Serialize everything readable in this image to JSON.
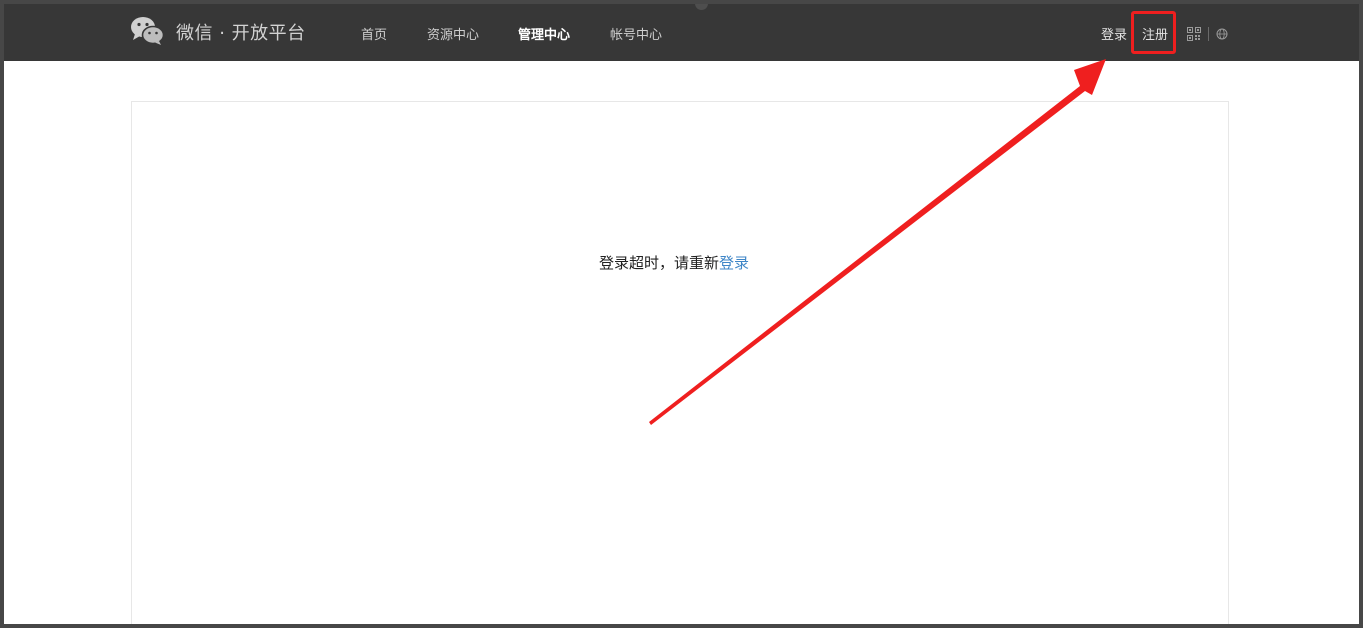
{
  "header": {
    "logo_text": "微信 · 开放平台",
    "nav": [
      {
        "label": "首页"
      },
      {
        "label": "资源中心"
      },
      {
        "label": "管理中心",
        "active": true
      },
      {
        "label": "帐号中心"
      }
    ],
    "login_label": "登录",
    "register_label": "注册",
    "qr_icon": "qr-code-icon",
    "globe_icon": "globe-icon"
  },
  "main": {
    "message_prefix": "登录超时，请重新",
    "relogin_link": "登录"
  },
  "colors": {
    "topbar_bg": "#373737",
    "link_blue": "#3f86c7",
    "annotation_red": "#ef1f1f"
  }
}
